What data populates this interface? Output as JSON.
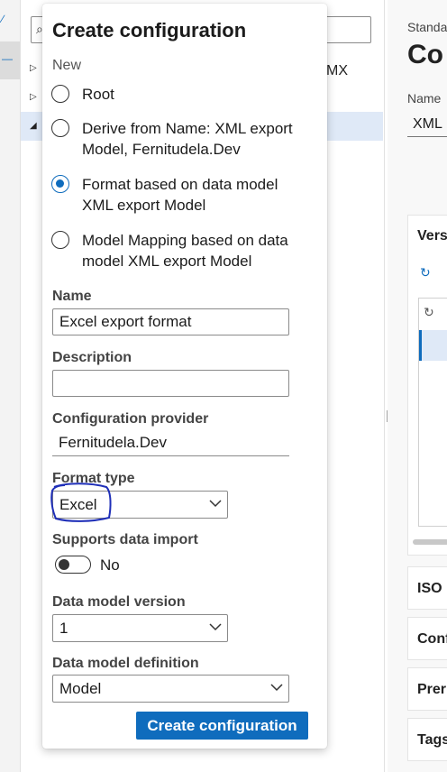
{
  "background": {
    "tree_item_suffix": "MX",
    "right_pane": {
      "breadcrumb": "Standa",
      "title": "Co",
      "name_label": "Name",
      "name_value": "XML",
      "versions_header": "Vers",
      "tab_iso": "ISO",
      "tab_conf": "Conf",
      "tab_prer": "Prer",
      "tab_tags": "Tags"
    }
  },
  "dialog": {
    "title": "Create configuration",
    "new_section_label": "New",
    "options": [
      {
        "label": "Root",
        "selected": false
      },
      {
        "label": "Derive from Name: XML export Model, Fernitudela.Dev",
        "selected": false
      },
      {
        "label": "Format based on data model XML export Model",
        "selected": true
      },
      {
        "label": "Model Mapping based on data model XML export Model",
        "selected": false
      }
    ],
    "name": {
      "label": "Name",
      "value": "Excel export format"
    },
    "description": {
      "label": "Description",
      "value": ""
    },
    "provider": {
      "label": "Configuration provider",
      "value": "Fernitudela.Dev"
    },
    "format_type": {
      "label": "Format type",
      "value": "Excel"
    },
    "supports_import": {
      "label": "Supports data import",
      "state_text": "No"
    },
    "model_version": {
      "label": "Data model version",
      "value": "1"
    },
    "model_definition": {
      "label": "Data model definition",
      "value": "Model"
    },
    "create_button": "Create configuration"
  },
  "colors": {
    "accent": "#0f6cbd",
    "annotation_ink": "#1f2fb8"
  }
}
